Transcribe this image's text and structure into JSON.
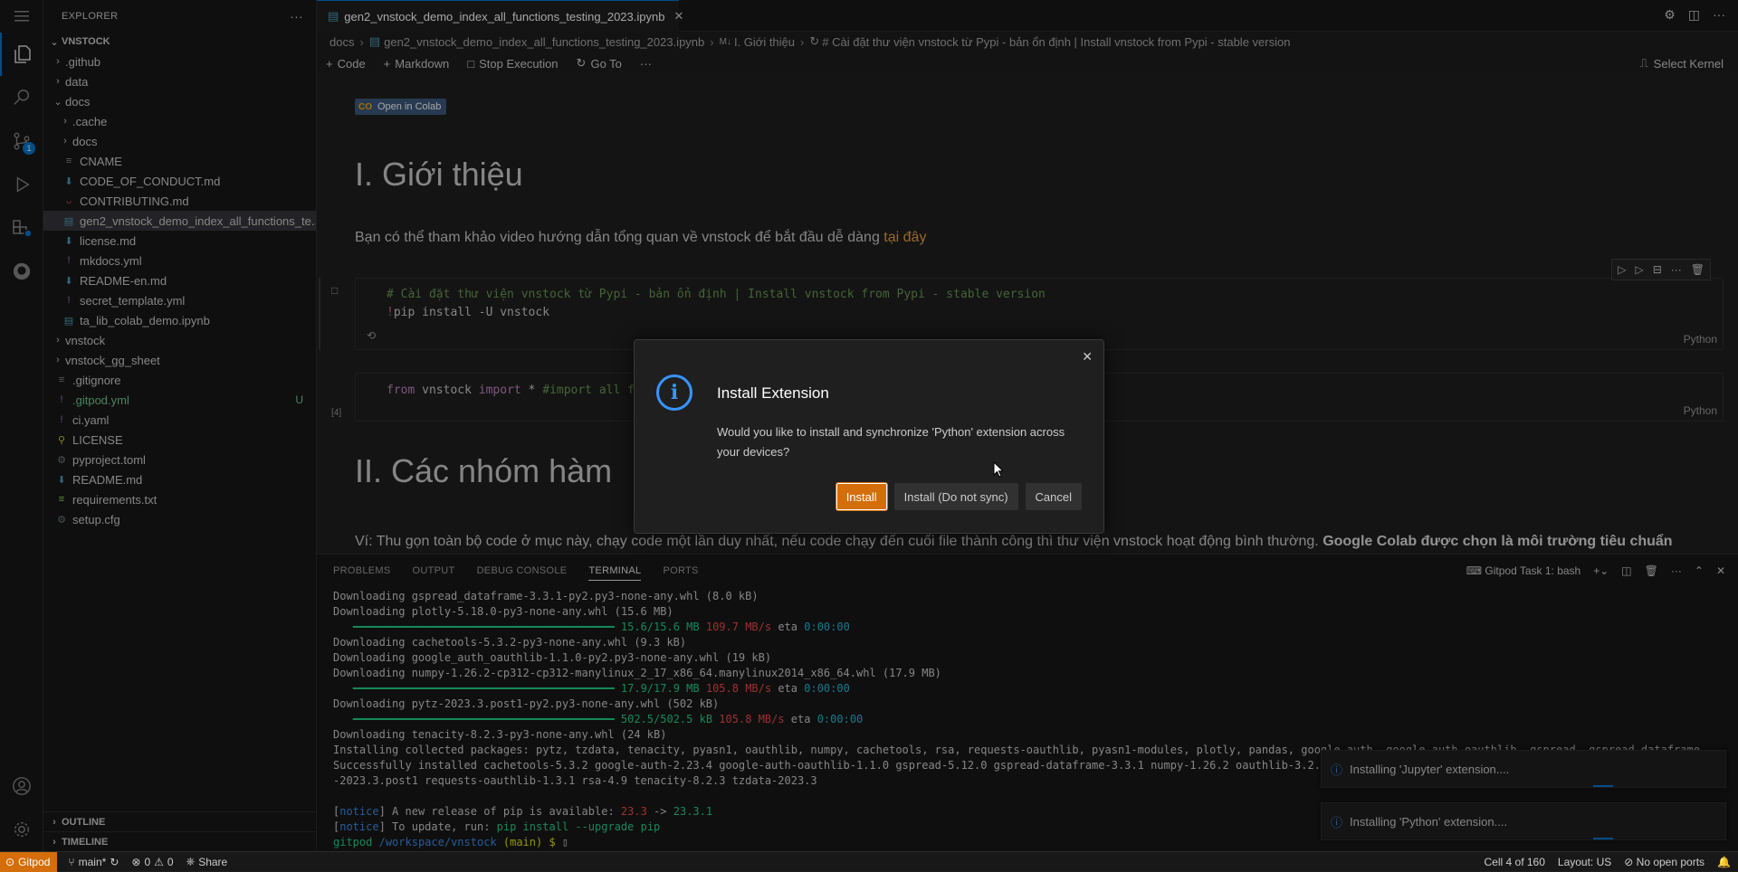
{
  "explorer": {
    "title": "EXPLORER",
    "root": "VNSTOCK",
    "items": [
      {
        "label": ".github",
        "kind": "folder",
        "state": "closed"
      },
      {
        "label": "data",
        "kind": "folder",
        "state": "closed"
      },
      {
        "label": "docs",
        "kind": "folder",
        "state": "open"
      },
      {
        "label": ".cache",
        "kind": "folder",
        "state": "closed"
      },
      {
        "label": "docs",
        "kind": "folder",
        "state": "closed"
      },
      {
        "label": "CNAME",
        "kind": "file"
      },
      {
        "label": "CODE_OF_CONDUCT.md",
        "kind": "file"
      },
      {
        "label": "CONTRIBUTING.md",
        "kind": "file"
      },
      {
        "label": "gen2_vnstock_demo_index_all_functions_te...",
        "kind": "file"
      },
      {
        "label": "license.md",
        "kind": "file"
      },
      {
        "label": "mkdocs.yml",
        "kind": "file"
      },
      {
        "label": "README-en.md",
        "kind": "file"
      },
      {
        "label": "secret_template.yml",
        "kind": "file"
      },
      {
        "label": "ta_lib_colab_demo.ipynb",
        "kind": "file"
      },
      {
        "label": "vnstock",
        "kind": "folder",
        "state": "closed"
      },
      {
        "label": "vnstock_gg_sheet",
        "kind": "folder",
        "state": "closed"
      },
      {
        "label": ".gitignore",
        "kind": "file"
      },
      {
        "label": ".gitpod.yml",
        "kind": "file",
        "git": "U"
      },
      {
        "label": "ci.yaml",
        "kind": "file"
      },
      {
        "label": "LICENSE",
        "kind": "file"
      },
      {
        "label": "pyproject.toml",
        "kind": "file"
      },
      {
        "label": "README.md",
        "kind": "file"
      },
      {
        "label": "requirements.txt",
        "kind": "file"
      },
      {
        "label": "setup.cfg",
        "kind": "file"
      }
    ],
    "outline": "OUTLINE",
    "timeline": "TIMELINE"
  },
  "tab": {
    "label": "gen2_vnstock_demo_index_all_functions_testing_2023.ipynb"
  },
  "breadcrumb": {
    "b1": "docs",
    "b2": "gen2_vnstock_demo_index_all_functions_testing_2023.ipynb",
    "b3": "I. Giới thiệu",
    "b4": "# Cài đặt thư viện vnstock từ Pypi - bản ổn định | Install vnstock from Pypi - stable version"
  },
  "toolbar": {
    "code": "Code",
    "markdown": "Markdown",
    "stop": "Stop Execution",
    "goto": "Go To",
    "kernel": "Select Kernel"
  },
  "notebook": {
    "colab": "Open in Colab",
    "h1": "I. Giới thiệu",
    "intro": "Bạn có thể tham khảo video hướng dẫn tổng quan về vnstock để bắt đầu dễ dàng",
    "intro_link": "tại đây",
    "cell1_line1": "# Cài đặt thư viện vnstock từ Pypi - bản ổn định | Install vnstock from Pypi - stable version",
    "cell1_bang": "!",
    "cell1_line2": "pip install -U vnstock",
    "cell1_lang": "Python",
    "cell2_from": "from",
    "cell2_mod": " vnstock ",
    "cell2_import": "import",
    "cell2_rest": " * ",
    "cell2_comment": "#import all fu",
    "cell2_exec": "[4]",
    "cell2_lang": "Python",
    "h2": "II. Các nhóm hàm",
    "p2_text": "Ví: Thu gọn toàn bộ code ở mục này, chạy code một lần duy nhất, nếu code chạy đến cuối file thành công thì thư viện vnstock hoạt động bình thường.",
    "p2_bold": "Google Colab được chọn là môi trường tiêu chuẩn"
  },
  "panel": {
    "tabs": [
      "PROBLEMS",
      "OUTPUT",
      "DEBUG CONSOLE",
      "TERMINAL",
      "PORTS"
    ],
    "terminal_name": "Gitpod Task 1: bash",
    "lines": {
      "l1": "Downloading gspread_dataframe-3.3.1-py2.py3-none-any.whl (8.0 kB)",
      "l2": "Downloading plotly-5.18.0-py3-none-any.whl (15.6 MB)",
      "l3a": "15.6/15.6 MB",
      "l3b": "109.7 MB/s",
      "l3c": "eta",
      "l3d": "0:00:00",
      "l4": "Downloading cachetools-5.3.2-py3-none-any.whl (9.3 kB)",
      "l5": "Downloading google_auth_oauthlib-1.1.0-py2.py3-none-any.whl (19 kB)",
      "l6": "Downloading numpy-1.26.2-cp312-cp312-manylinux_2_17_x86_64.manylinux2014_x86_64.whl (17.9 MB)",
      "l7a": "17.9/17.9 MB",
      "l7b": "105.8 MB/s",
      "l8": "Downloading pytz-2023.3.post1-py2.py3-none-any.whl (502 kB)",
      "l9a": "502.5/502.5 kB",
      "l9b": "105.8 MB/s",
      "l10": "Downloading tenacity-8.2.3-py3-none-any.whl (24 kB)",
      "l11": "Installing collected packages: pytz, tzdata, tenacity, pyasn1, oauthlib, numpy, cachetools, rsa, requests-oauthlib, pyasn1-modules, plotly, pandas, google-auth, google-auth-oauthlib, gspread, gspread-dataframe",
      "l12": "Successfully installed cachetools-5.3.2 google-auth-2.23.4 google-auth-oauthlib-1.1.0 gspread-5.12.0 gspread-dataframe-3.3.1 numpy-1.26.2 oauthlib-3.2.2 pan",
      "l13": "-2023.3.post1 requests-oauthlib-1.3.1 rsa-4.9 tenacity-8.2.3 tzdata-2023.3",
      "notice": "notice",
      "l15a": "A new release of pip is available:",
      "l15b": "23.3",
      "l15c": "->",
      "l15d": "23.3.1",
      "l16a": "To update, run:",
      "l16b": "pip install --upgrade pip",
      "p1": "gitpod",
      "p2": "/workspace/vnstock",
      "p3": "(main) $"
    }
  },
  "toasts": {
    "t1": "Installing 'Jupyter' extension....",
    "t2": "Installing 'Python' extension...."
  },
  "dialog": {
    "title": "Install Extension",
    "message": "Would you like to install and synchronize 'Python' extension across your devices?",
    "install": "Install",
    "install_nosync": "Install (Do not sync)",
    "cancel": "Cancel"
  },
  "statusbar": {
    "remote": "Gitpod",
    "branch": "main*",
    "errors": "0",
    "warnings": "0",
    "share": "Share",
    "cell": "Cell 4 of 160",
    "layout": "Layout: US",
    "ports": "No open ports"
  },
  "colors": {
    "accent": "#0078d4",
    "remote": "#d36e0a",
    "info": "#3794ff"
  }
}
